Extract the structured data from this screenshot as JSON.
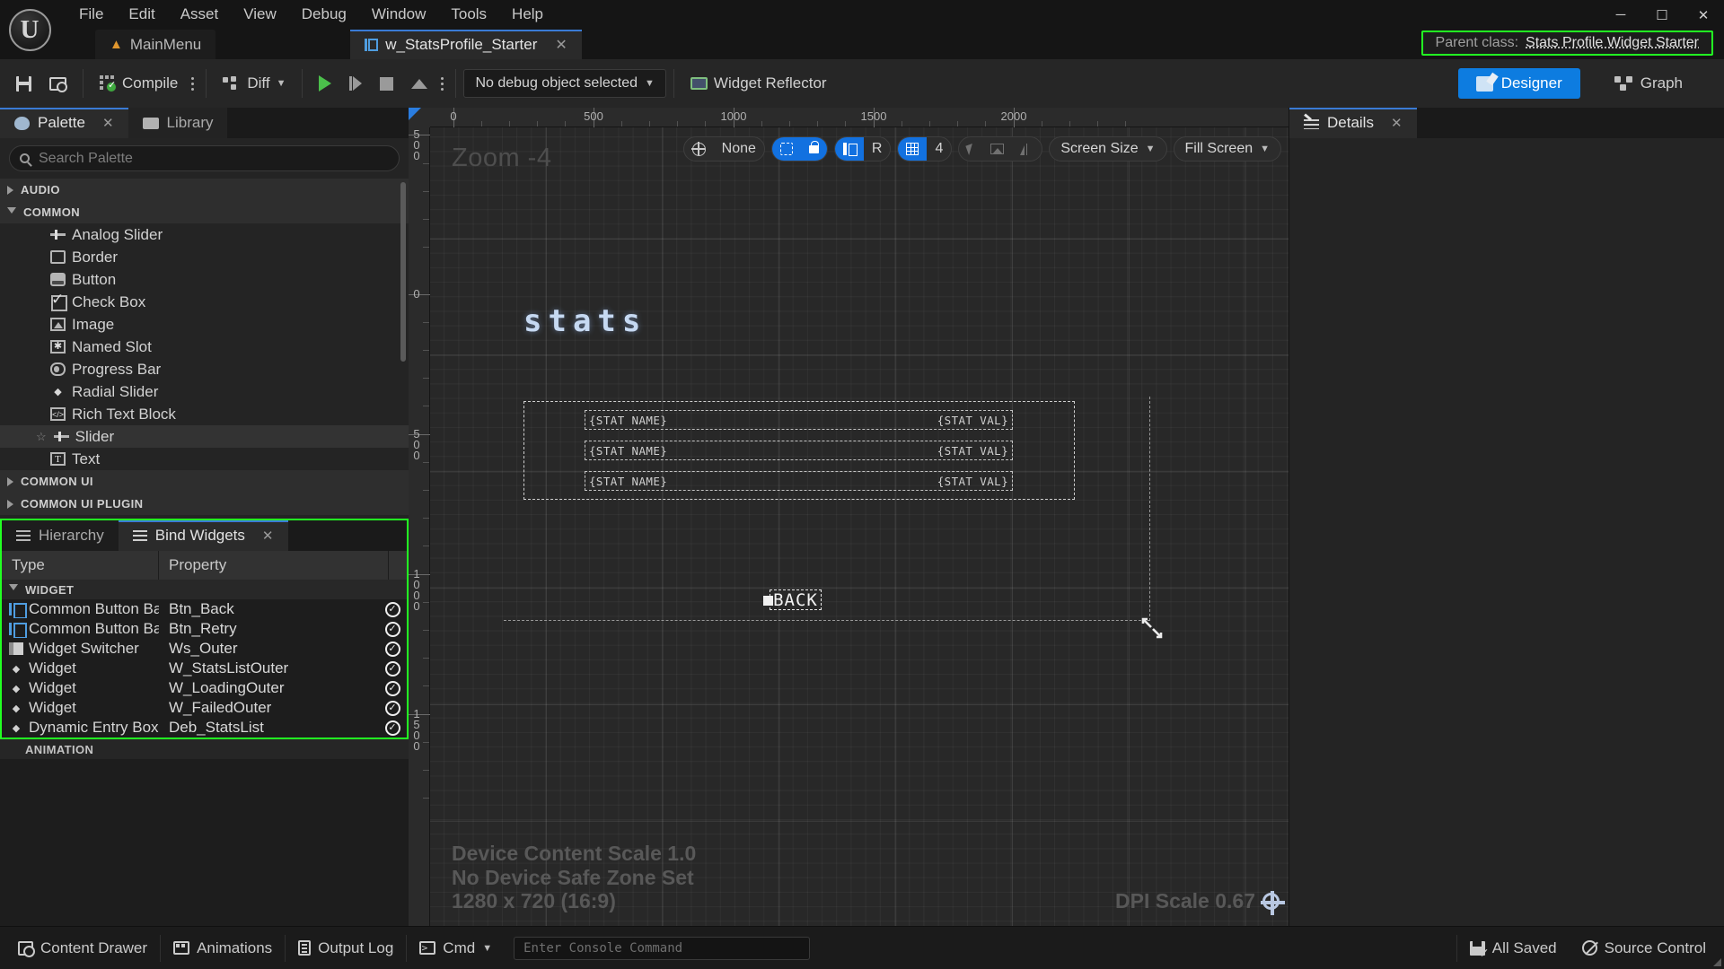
{
  "titlebar": {
    "menus": [
      "File",
      "Edit",
      "Asset",
      "View",
      "Debug",
      "Window",
      "Tools",
      "Help"
    ],
    "tabs": [
      {
        "label": "MainMenu",
        "icon": "level-icon",
        "active": false
      },
      {
        "label": "w_StatsProfile_Starter",
        "icon": "widget-blueprint-icon",
        "active": true
      }
    ],
    "tab_close_glyph": "✕",
    "window_controls": {
      "minimize": "─",
      "maximize": "☐",
      "close": "✕"
    },
    "parent_class": {
      "label": "Parent class:",
      "value": "Stats Profile Widget Starter",
      "highlight_color": "#22ff22"
    }
  },
  "toolbar": {
    "save_label": "",
    "browse_label": "",
    "compile_label": "Compile",
    "diff_label": "Diff",
    "debug_object": "No debug object selected",
    "widget_reflector": "Widget Reflector",
    "designer_label": "Designer",
    "graph_label": "Graph",
    "active_mode": "Designer",
    "accent_color": "#0d7ce0"
  },
  "palette": {
    "tabs": [
      {
        "label": "Palette",
        "icon": "palette-icon",
        "active": true,
        "closable": true
      },
      {
        "label": "Library",
        "icon": "folder-icon",
        "active": false,
        "closable": false
      }
    ],
    "close_glyph": "✕",
    "search_placeholder": "Search Palette",
    "search_value": "",
    "categories": [
      {
        "name": "AUDIO",
        "expanded": false,
        "items": []
      },
      {
        "name": "COMMON",
        "expanded": true,
        "items": [
          {
            "label": "Analog Slider",
            "icon": "slider-icon",
            "favorite": false,
            "highlighted": false
          },
          {
            "label": "Border",
            "icon": "border-icon",
            "favorite": false,
            "highlighted": false
          },
          {
            "label": "Button",
            "icon": "button-icon",
            "favorite": false,
            "highlighted": false
          },
          {
            "label": "Check Box",
            "icon": "checkbox-icon",
            "favorite": false,
            "highlighted": false
          },
          {
            "label": "Image",
            "icon": "image-icon",
            "favorite": false,
            "highlighted": false
          },
          {
            "label": "Named Slot",
            "icon": "named-slot-icon",
            "favorite": false,
            "highlighted": false
          },
          {
            "label": "Progress Bar",
            "icon": "progress-bar-icon",
            "favorite": false,
            "highlighted": false
          },
          {
            "label": "Radial Slider",
            "icon": "radial-slider-icon",
            "favorite": false,
            "highlighted": false
          },
          {
            "label": "Rich Text Block",
            "icon": "rich-text-icon",
            "favorite": false,
            "highlighted": false
          },
          {
            "label": "Slider",
            "icon": "slider-icon",
            "favorite": true,
            "highlighted": true
          },
          {
            "label": "Text",
            "icon": "text-icon",
            "favorite": false,
            "highlighted": false
          }
        ]
      },
      {
        "name": "COMMON UI",
        "expanded": false,
        "items": []
      },
      {
        "name": "COMMON UI PLUGIN",
        "expanded": false,
        "items": []
      }
    ]
  },
  "bind_widgets": {
    "tabs": [
      {
        "label": "Hierarchy",
        "icon": "list-icon",
        "active": false,
        "closable": false
      },
      {
        "label": "Bind Widgets",
        "icon": "list-icon",
        "active": true,
        "closable": true
      }
    ],
    "close_glyph": "✕",
    "highlight_color": "#22ff22",
    "columns": [
      "Type",
      "Property"
    ],
    "group_label": "WIDGET",
    "rows": [
      {
        "type": "Common Button Base",
        "property": "Btn_Back",
        "icon": "common-button-base-icon",
        "bound": true
      },
      {
        "type": "Common Button Base",
        "property": "Btn_Retry",
        "icon": "common-button-base-icon",
        "bound": true
      },
      {
        "type": "Widget Switcher",
        "property": "Ws_Outer",
        "icon": "widget-switcher-icon",
        "bound": true
      },
      {
        "type": "Widget",
        "property": "W_StatsListOuter",
        "icon": "widget-icon",
        "bound": true
      },
      {
        "type": "Widget",
        "property": "W_LoadingOuter",
        "icon": "widget-icon",
        "bound": true
      },
      {
        "type": "Widget",
        "property": "W_FailedOuter",
        "icon": "widget-icon",
        "bound": true
      },
      {
        "type": "Dynamic Entry Box",
        "property": "Deb_StatsList",
        "icon": "widget-icon",
        "bound": true
      }
    ],
    "animation_label": "ANIMATION",
    "check_glyph": "✓"
  },
  "viewport": {
    "zoom_label": "Zoom -4",
    "ruler_h_labels": [
      "0",
      "500",
      "1000",
      "1500",
      "2000"
    ],
    "ruler_v_labels": [
      "500",
      "0",
      "500",
      "1000",
      "1500"
    ],
    "tools": {
      "locale_label": "None",
      "locale_icon": "globe-icon",
      "dashed_box_icon": "selection-outline-icon",
      "lock_icon": "lock-icon",
      "anchor_icon": "anchor-icon",
      "rotate_label": "R",
      "grid_icon": "grid-icon",
      "grid_size": "4",
      "cursor_icon": "cursor-icon",
      "mountain_icon": "image-preview-icon",
      "mirror_icon": "mirror-icon",
      "screen_size_label": "Screen Size",
      "fill_screen_label": "Fill Screen"
    },
    "preview": {
      "title": "stats",
      "stat_rows": [
        {
          "name": "{STAT NAME}",
          "value": "{STAT VAL}"
        },
        {
          "name": "{STAT NAME}",
          "value": "{STAT VAL}"
        },
        {
          "name": "{STAT NAME}",
          "value": "{STAT VAL}"
        }
      ],
      "back_button": "BACK"
    },
    "overlay": {
      "device_content_scale": "Device Content Scale 1.0",
      "safe_zone": "No Device Safe Zone Set",
      "resolution": "1280 x 720 (16:9)",
      "dpi_scale": "DPI Scale 0.67",
      "gear_icon": "settings-gear-icon"
    }
  },
  "details": {
    "tabs": [
      {
        "label": "Details",
        "icon": "details-icon",
        "active": true,
        "closable": true
      }
    ],
    "close_glyph": "✕"
  },
  "statusbar": {
    "content_drawer": "Content Drawer",
    "animations": "Animations",
    "output_log": "Output Log",
    "cmd_label": "Cmd",
    "console_placeholder": "Enter Console Command",
    "all_saved": "All Saved",
    "source_control": "Source Control"
  }
}
